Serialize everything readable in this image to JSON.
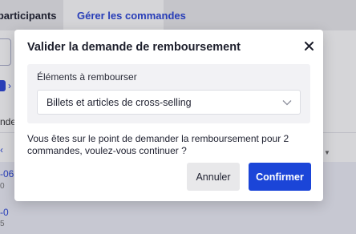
{
  "tabs": {
    "participants_label": "s participants",
    "orders_label": "Gérer les commandes"
  },
  "background": {
    "partial_text": "nde",
    "row1_id": "-06",
    "row1_sub": "0",
    "row2_id": "-0",
    "row2_sub": "5"
  },
  "modal": {
    "title": "Valider la demande de remboursement",
    "items_label": "Éléments à rembourser",
    "items_selected": "Billets et articles de cross-selling",
    "message": "Vous êtes sur le point de demander la remboursement pour 2 commandes, voulez-vous continuer ?",
    "cancel_label": "Annuler",
    "confirm_label": "Confirmer"
  },
  "colors": {
    "accent": "#1b45d8",
    "tab_active_text": "#2c47d8"
  }
}
